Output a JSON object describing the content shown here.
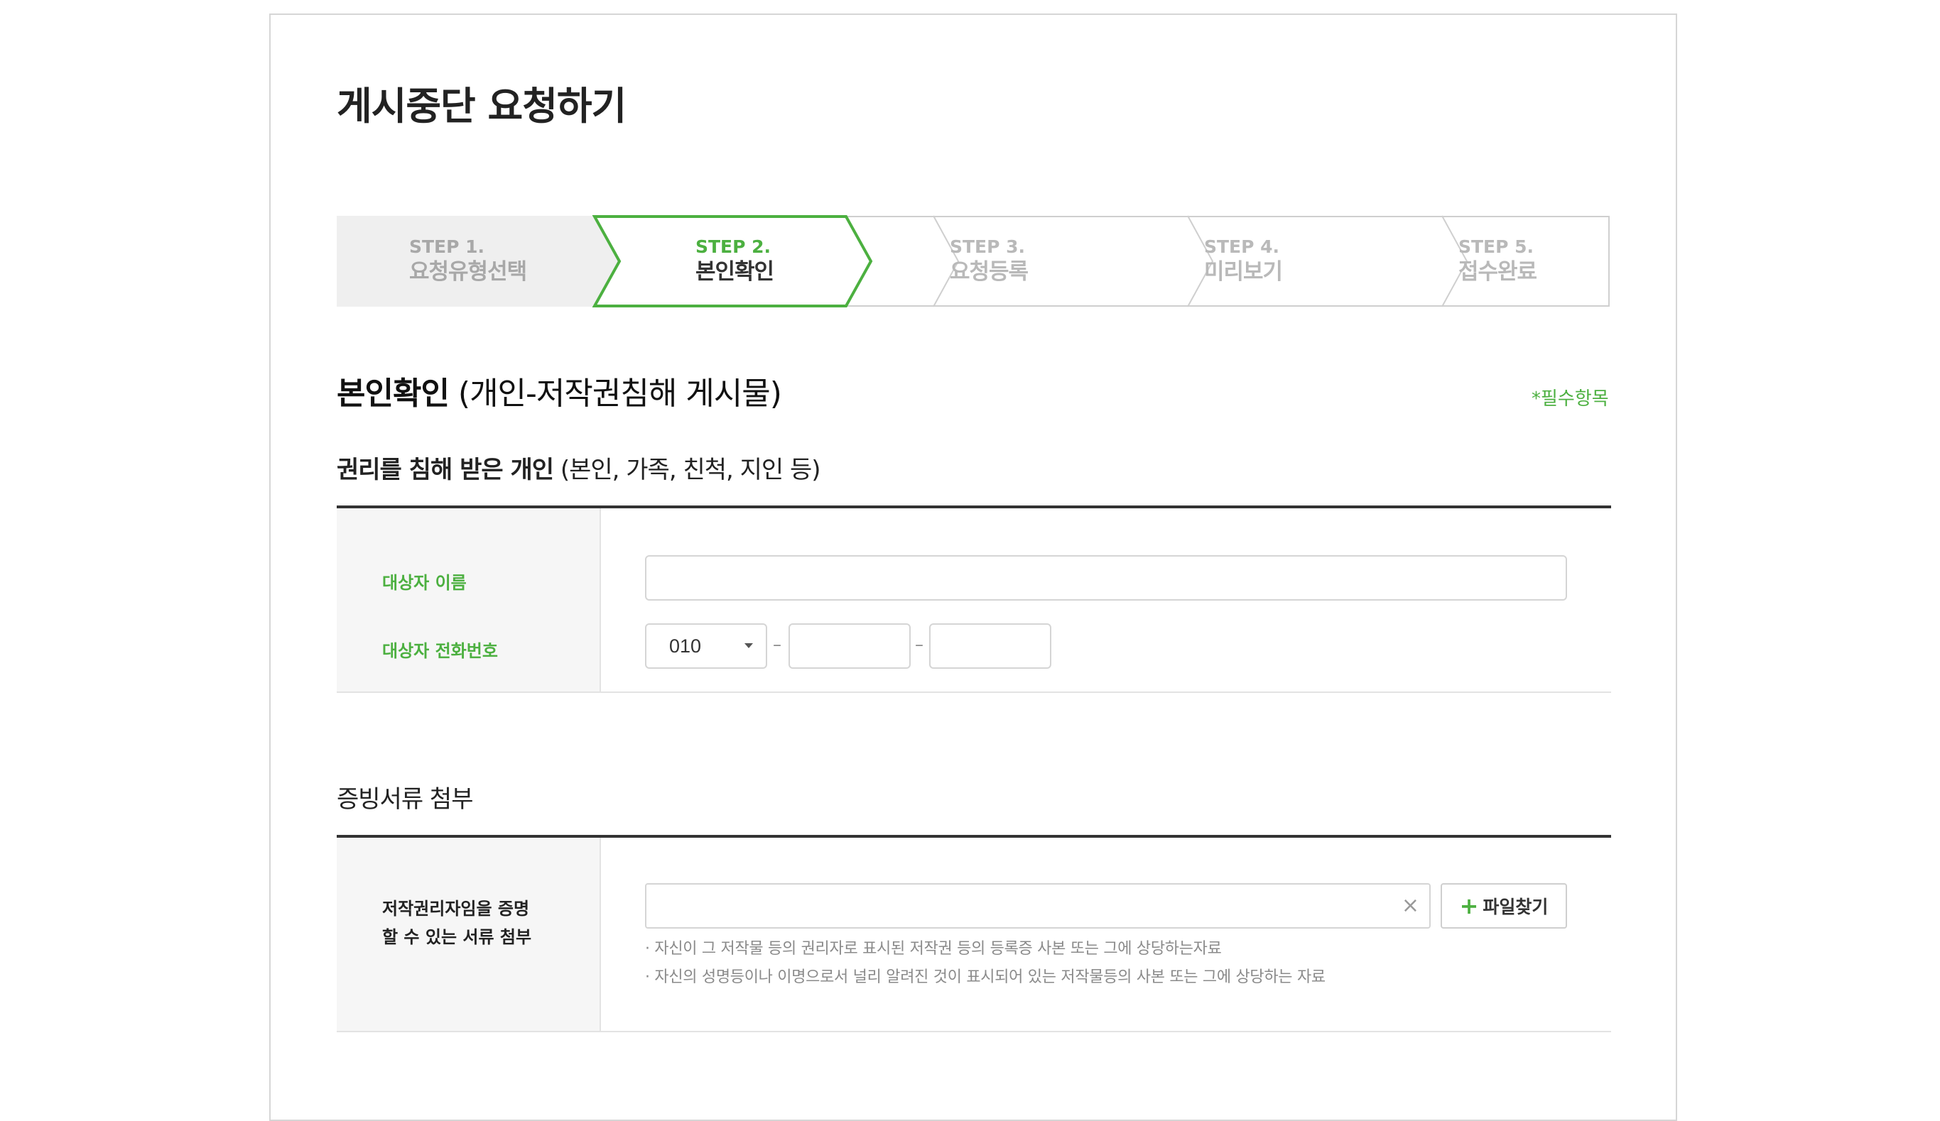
{
  "page": {
    "title": "게시중단 요청하기"
  },
  "stepper": {
    "steps": [
      {
        "num": "STEP 1.",
        "name": "요청유형선택",
        "state": "done"
      },
      {
        "num": "STEP 2.",
        "name": "본인확인",
        "state": "active"
      },
      {
        "num": "STEP 3.",
        "name": "요청등록",
        "state": "upcoming"
      },
      {
        "num": "STEP 4.",
        "name": "미리보기",
        "state": "upcoming"
      },
      {
        "num": "STEP 5.",
        "name": "접수완료",
        "state": "upcoming"
      }
    ]
  },
  "identity": {
    "heading_bold": "본인확인",
    "heading_rest": " (개인-저작권침해 게시물)",
    "required_note": "*필수항목",
    "sub_bold": "권리를 침해 받은 개인",
    "sub_rest": " (본인, 가족, 친척, 지인 등)",
    "name_label": "대상자 이름",
    "name_value": "",
    "phone_label": "대상자 전화번호",
    "phone_prefix": "010",
    "phone_mid": "",
    "phone_last": "",
    "dash": "–"
  },
  "attachment": {
    "heading": "증빙서류 첨부",
    "label_line1": "저작권리자임을 증명",
    "label_line2": "할 수 있는 서류 첨부",
    "clear_icon": "×",
    "find_button": "파일찾기",
    "hint1": "· 자신이 그 저작물 등의 권리자로 표시된 저작권 등의 등록증 사본 또는 그에 상당하는자료",
    "hint2": "· 자신의 성명등이나 이명으로서 널리 알려진 것이 표시되어 있는 저작물등의 사본 또는 그에 상당하는 자료"
  },
  "colors": {
    "accent": "#4cb040",
    "border": "#cfcfcf",
    "done_bg": "#efefef"
  }
}
